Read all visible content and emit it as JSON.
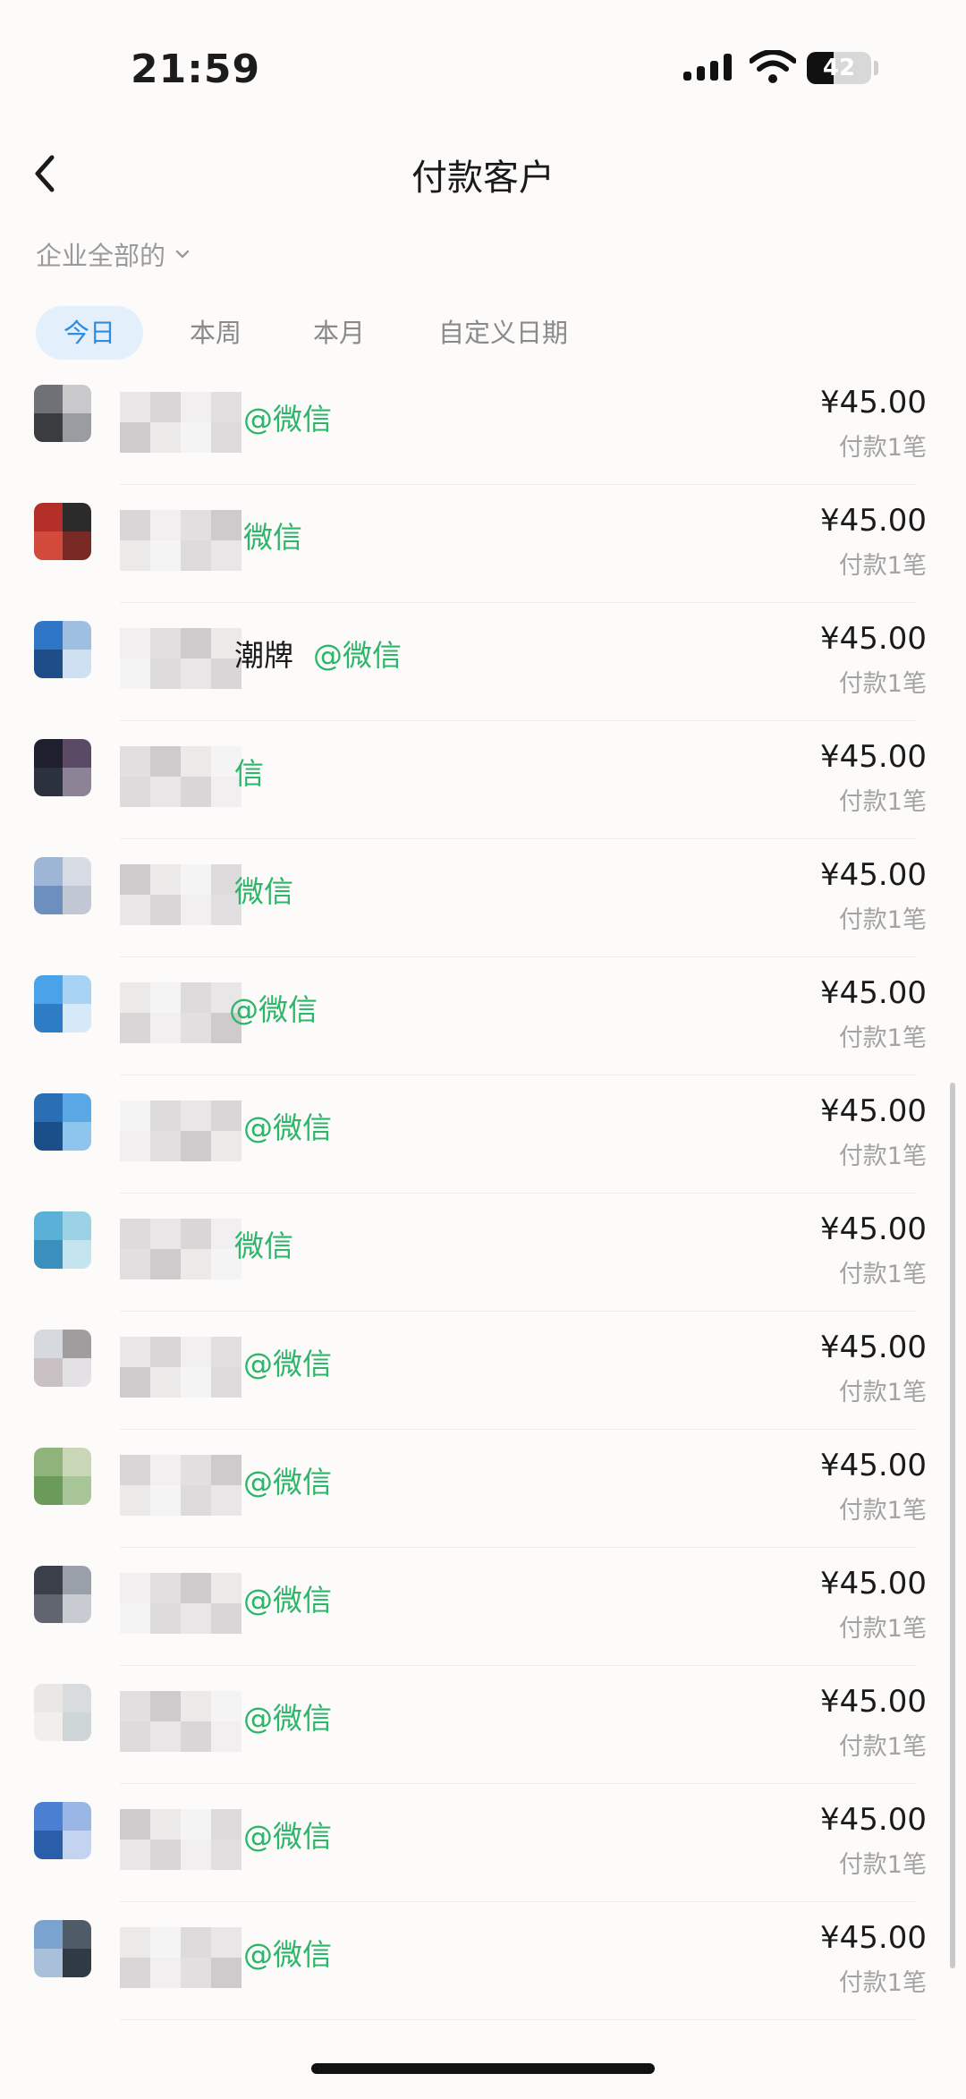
{
  "status_bar": {
    "time": "21:59",
    "battery": "42",
    "battery_level": 0.42
  },
  "nav": {
    "title": "付款客户"
  },
  "filter": {
    "label": "企业全部的"
  },
  "tabs": [
    {
      "label": "今日",
      "active": true
    },
    {
      "label": "本周",
      "active": false
    },
    {
      "label": "本月",
      "active": false
    },
    {
      "label": "自定义日期",
      "active": false
    }
  ],
  "customers": [
    {
      "name": "",
      "tag": "@微信",
      "amount": "¥45.00",
      "count": "付款1笔"
    },
    {
      "name": "",
      "tag": "微信",
      "amount": "¥45.00",
      "count": "付款1笔"
    },
    {
      "name": "潮牌",
      "tag": "@微信",
      "amount": "¥45.00",
      "count": "付款1笔"
    },
    {
      "name": "",
      "tag": "信",
      "amount": "¥45.00",
      "count": "付款1笔"
    },
    {
      "name": "",
      "tag": "微信",
      "amount": "¥45.00",
      "count": "付款1笔"
    },
    {
      "name": "",
      "tag": "@微信",
      "amount": "¥45.00",
      "count": "付款1笔"
    },
    {
      "name": "",
      "tag": "@微信",
      "amount": "¥45.00",
      "count": "付款1笔"
    },
    {
      "name": "",
      "tag": "微信",
      "amount": "¥45.00",
      "count": "付款1笔"
    },
    {
      "name": "",
      "tag": "@微信",
      "amount": "¥45.00",
      "count": "付款1笔"
    },
    {
      "name": "",
      "tag": "@微信",
      "amount": "¥45.00",
      "count": "付款1笔"
    },
    {
      "name": "",
      "tag": "@微信",
      "amount": "¥45.00",
      "count": "付款1笔"
    },
    {
      "name": "",
      "tag": "@微信",
      "amount": "¥45.00",
      "count": "付款1笔"
    },
    {
      "name": "",
      "tag": "@微信",
      "amount": "¥45.00",
      "count": "付款1笔"
    },
    {
      "name": "",
      "tag": "@微信",
      "amount": "¥45.00",
      "count": "付款1笔"
    }
  ],
  "colors": {
    "accent": "#2f8de0",
    "wechat_green": "#2db56a",
    "tab_active_bg": "#e3f0fb"
  },
  "icons": {
    "back": "chevron-left-icon",
    "filter": "chevron-down-icon",
    "signal": "cellular-signal-icon",
    "wifi": "wifi-icon",
    "battery": "battery-icon"
  }
}
